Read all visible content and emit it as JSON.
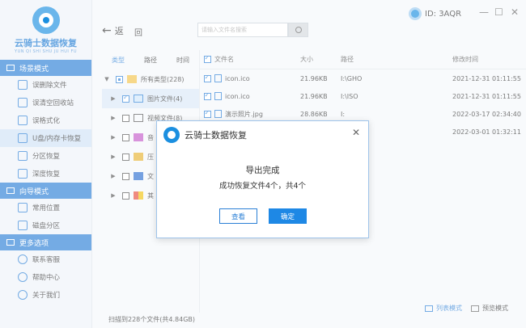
{
  "app": {
    "title": "云骑士数据恢复",
    "subtitle": "YUN QI SHI SHU JU HUI FU"
  },
  "user": {
    "id": "ID: 3AQR"
  },
  "window": {
    "minimize": "—",
    "restore": "☐",
    "close": "✕"
  },
  "sidebar": {
    "sections": [
      {
        "label": "场景模式",
        "items": [
          "误删除文件",
          "误清空回收站",
          "误格式化",
          "U盘/内存卡恢复",
          "分区恢复",
          "深度恢复"
        ]
      },
      {
        "label": "向导模式",
        "items": [
          "常用位置",
          "磁盘分区"
        ]
      },
      {
        "label": "更多选项",
        "items": [
          "联系客服",
          "帮助中心",
          "关于我们"
        ]
      }
    ]
  },
  "toolbar": {
    "back": "返",
    "home": "回",
    "search_placeholder": "请输入文件名搜索"
  },
  "tree": {
    "tabs": [
      "类型",
      "路径",
      "时间"
    ],
    "rows": [
      {
        "label": "所有类型(228)"
      },
      {
        "label": "图片文件(4)"
      },
      {
        "label": "视频文件(8)"
      },
      {
        "label": "音"
      },
      {
        "label": "压"
      },
      {
        "label": "文"
      },
      {
        "label": "其"
      }
    ]
  },
  "list": {
    "headers": {
      "name": "文件名",
      "size": "大小",
      "path": "路径",
      "time": "修改时间"
    },
    "rows": [
      {
        "name": "icon.ico",
        "size": "21.96KB",
        "path": "I:\\GHO",
        "time": "2021-12-31 01:11:55"
      },
      {
        "name": "icon.ico",
        "size": "21.96KB",
        "path": "I:\\ISO",
        "time": "2021-12-31 01:11:55"
      },
      {
        "name": "演示照片.jpg",
        "size": "28.86KB",
        "path": "I:",
        "time": "2022-03-17 02:34:40"
      },
      {
        "name": "",
        "size": "",
        "path": "",
        "time": "2022-03-01 01:32:11"
      }
    ]
  },
  "views": {
    "list": "列表模式",
    "preview": "预览模式"
  },
  "status": "扫描到228个文件(共4.84GB)",
  "dialog": {
    "title": "云骑士数据恢复",
    "message": "导出完成",
    "detail": "成功恢复文件4个，共4个",
    "view_button": "查看",
    "ok_button": "确定"
  }
}
